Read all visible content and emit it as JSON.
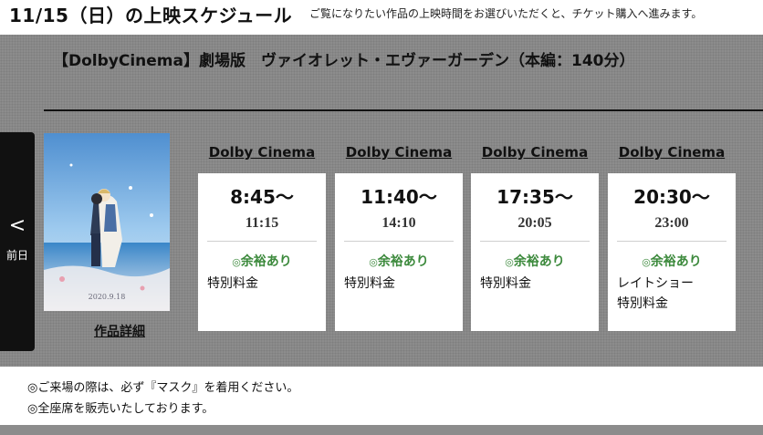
{
  "header": {
    "date_title": "11/15（日）の上映スケジュール",
    "note": "ご覧になりたい作品の上映時間をお選びいただくと、チケット購入へ進みます。"
  },
  "movie": {
    "title": "【DolbyCinema】劇場版　ヴァイオレット・エヴァーガーデン（本編：140分）",
    "detail_link": "作品詳細",
    "poster_date": "2020.9.18"
  },
  "nav": {
    "prev_icon": "chevron-left-icon",
    "prev_chevron": "<",
    "prev_label": "前日"
  },
  "showtimes": [
    {
      "screen": "Dolby Cinema",
      "start": "8:45〜",
      "end": "11:15",
      "availability_mark": "◎",
      "availability": "余裕あり",
      "notes": [
        "特別料金"
      ]
    },
    {
      "screen": "Dolby Cinema",
      "start": "11:40〜",
      "end": "14:10",
      "availability_mark": "◎",
      "availability": "余裕あり",
      "notes": [
        "特別料金"
      ]
    },
    {
      "screen": "Dolby Cinema",
      "start": "17:35〜",
      "end": "20:05",
      "availability_mark": "◎",
      "availability": "余裕あり",
      "notes": [
        "特別料金"
      ]
    },
    {
      "screen": "Dolby Cinema",
      "start": "20:30〜",
      "end": "23:00",
      "availability_mark": "◎",
      "availability": "余裕あり",
      "notes": [
        "レイトショー",
        "特別料金"
      ]
    }
  ],
  "footer": {
    "notes": [
      "◎ご来場の際は、必ず『マスク』を着用ください。",
      "◎全座席を販売いたしております。"
    ]
  },
  "colors": {
    "panel_bg": "#8c8c8c",
    "availability": "#3d8a3d",
    "nav_bg": "#111111"
  }
}
